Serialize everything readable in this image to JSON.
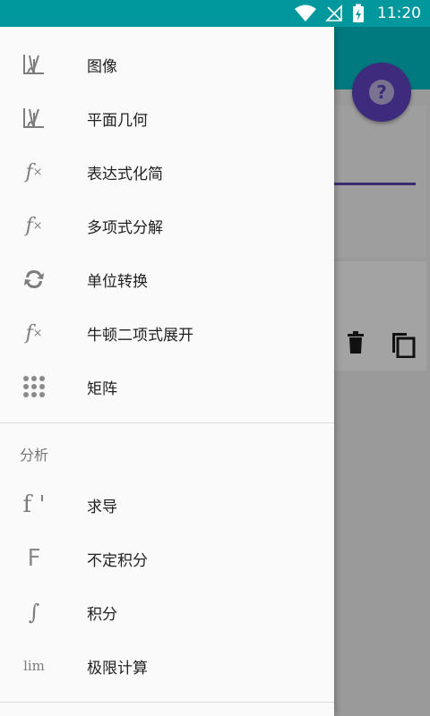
{
  "status": {
    "time": "11:20",
    "wifi_icon": "wifi-icon",
    "signal_icon": "no-signal-icon",
    "battery_icon": "battery-charging-icon"
  },
  "background": {
    "fab_label": "?",
    "delete_icon": "trash-icon",
    "copy_icon": "copy-icon"
  },
  "drawer": {
    "items": [
      {
        "label": "图像",
        "icon": "graph-icon"
      },
      {
        "label": "平面几何",
        "icon": "graph-icon"
      },
      {
        "label": "表达式化简",
        "icon": "fx-icon"
      },
      {
        "label": "多项式分解",
        "icon": "fx-icon"
      },
      {
        "label": "单位转换",
        "icon": "convert-icon"
      },
      {
        "label": "牛顿二项式展开",
        "icon": "fx-icon"
      },
      {
        "label": "矩阵",
        "icon": "matrix-icon"
      }
    ],
    "section_title": "分析",
    "analysis_items": [
      {
        "label": "求导",
        "glyph": "f '",
        "icon": "derivative-icon"
      },
      {
        "label": "不定积分",
        "glyph": "F",
        "icon": "antiderivative-icon"
      },
      {
        "label": "积分",
        "glyph": "∫",
        "icon": "integral-icon"
      },
      {
        "label": "极限计算",
        "glyph": "lim",
        "icon": "limit-icon"
      }
    ],
    "fx_glyph": "f",
    "fx_sub": "×"
  }
}
